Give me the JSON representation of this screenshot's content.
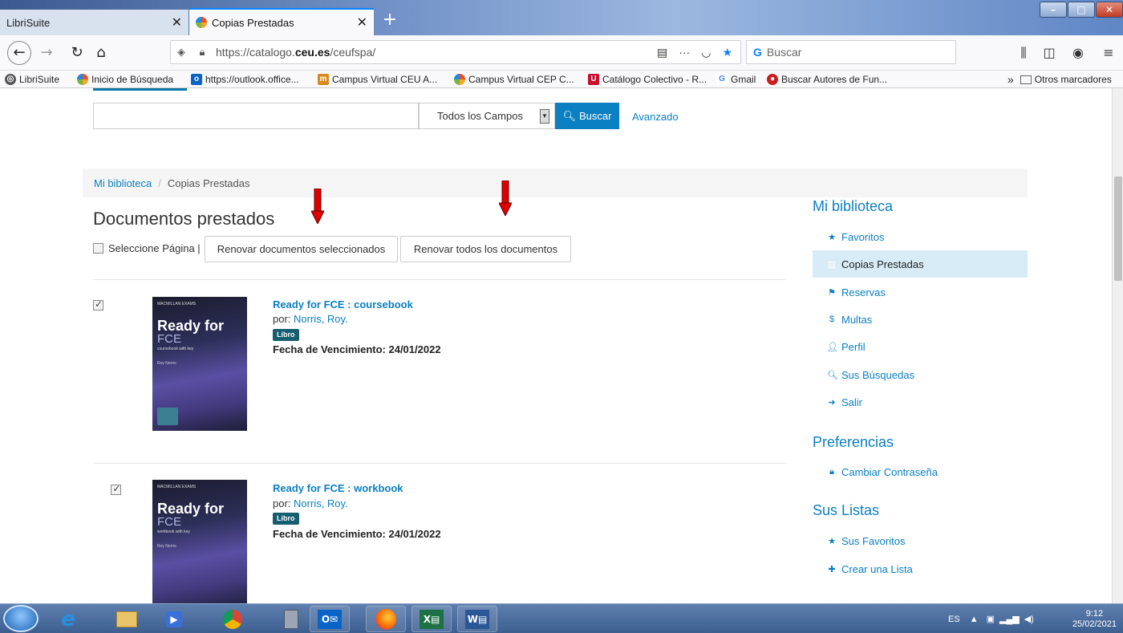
{
  "browser": {
    "tabs": [
      {
        "label": "LibriSuite"
      },
      {
        "label": "Copias Prestadas"
      }
    ],
    "new_tab": "+",
    "url_prefix": "https://catalogo.",
    "url_domain": "ceu.es",
    "url_path": "/ceufspa/",
    "search_placeholder": "Buscar",
    "url_more": "···"
  },
  "bookmarks": [
    {
      "label": "LibriSuite",
      "color": "#555555"
    },
    {
      "label": "Inicio de Búsqueda",
      "color": "#e84f2a"
    },
    {
      "label": "https://outlook.office...",
      "color": "#0a64c8"
    },
    {
      "label": "Campus Virtual CEU A...",
      "color": "#d98a1c"
    },
    {
      "label": "Campus Virtual CEP C...",
      "color": "#e84f2a"
    },
    {
      "label": "Catálogo Colectivo - R...",
      "color": "#c8102e"
    },
    {
      "label": "Gmail",
      "color": "#4285f4"
    },
    {
      "label": "Buscar Autores de Fun...",
      "color": "#c81e1e"
    }
  ],
  "bookmarks_other": "Otros marcadores",
  "search": {
    "field_select": "Todos los Campos",
    "button": "Buscar",
    "advanced": "Avanzado"
  },
  "breadcrumb": {
    "home": "Mi biblioteca",
    "sep": "/",
    "current": "Copias Prestadas"
  },
  "main": {
    "title": "Documentos prestados",
    "select_page": "Seleccione Página |",
    "renew_selected": "Renovar documentos seleccionados",
    "renew_all": "Renovar todos los documentos",
    "items": [
      {
        "checked": true,
        "title": "Ready for FCE : coursebook",
        "by": "por:",
        "author": "Norris, Roy.",
        "format": "Libro",
        "due": "Fecha de Vencimiento: 24/01/2022",
        "cover_line1": "Ready for",
        "cover_line2": "FCE",
        "cover_line3": "coursebook with key",
        "cover_author": "Roy Norris",
        "cover_publisher": "MACMILLAN EXAMS"
      },
      {
        "checked": true,
        "title": "Ready for FCE : workbook",
        "by": "por:",
        "author": "Norris, Roy.",
        "format": "Libro",
        "due": "Fecha de Vencimiento: 24/01/2022",
        "cover_line1": "Ready for",
        "cover_line2": "FCE",
        "cover_line3": "workbook with key",
        "cover_author": "Roy Norris",
        "cover_publisher": "MACMILLAN EXAMS"
      }
    ]
  },
  "sidebar": {
    "sections": [
      {
        "heading": "Mi biblioteca",
        "items": [
          {
            "label": "Favoritos",
            "icon": "star-icon"
          },
          {
            "label": "Copias Prestadas",
            "icon": "book-icon",
            "active": true
          },
          {
            "label": "Reservas",
            "icon": "flag-icon"
          },
          {
            "label": "Multas",
            "icon": "dollar-icon"
          },
          {
            "label": "Perfil",
            "icon": "user-icon"
          },
          {
            "label": "Sus Búsquedas",
            "icon": "search-icon"
          },
          {
            "label": "Salir",
            "icon": "sign-out-icon"
          }
        ]
      },
      {
        "heading": "Preferencias",
        "items": [
          {
            "label": "Cambiar Contraseña",
            "icon": "lock-icon"
          }
        ]
      },
      {
        "heading": "Sus Listas",
        "items": [
          {
            "label": "Sus Favoritos",
            "icon": "star-icon"
          },
          {
            "label": "Crear una Lista",
            "icon": "plus-icon"
          }
        ]
      }
    ]
  },
  "taskbar": {
    "lang": "ES",
    "time": "9:12",
    "date": "25/02/2021"
  },
  "colors": {
    "link": "#0a7fc2",
    "accent": "#0a7fc2",
    "active_bg": "#d7ecf6",
    "arrow": "#e00000"
  }
}
